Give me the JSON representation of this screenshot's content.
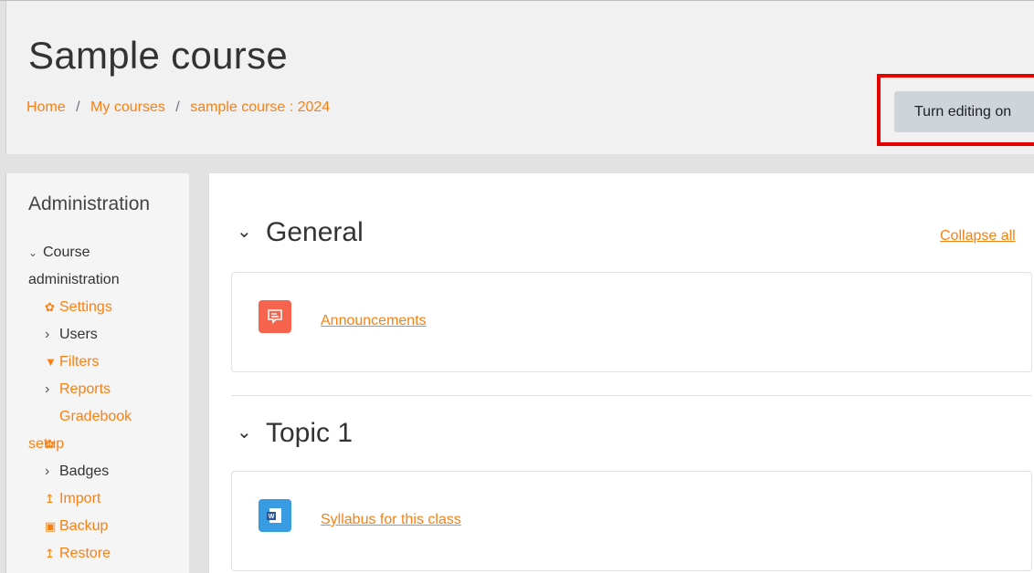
{
  "page": {
    "title": "Sample course"
  },
  "breadcrumb": {
    "items": [
      "Home",
      "My courses",
      "sample course : 2024"
    ],
    "separator": "/"
  },
  "header": {
    "edit_button_label": "Turn editing on"
  },
  "colors": {
    "accent": "#f98012",
    "highlight_border": "#e60000",
    "announcement_icon_bg": "#f7634d",
    "file_icon_bg": "#399be2"
  },
  "sidebar": {
    "title": "Administration",
    "section_label": "Course administration",
    "items": [
      {
        "label": "Settings",
        "icon": "gear-icon"
      },
      {
        "label": "Users",
        "icon": "chevron-right-icon"
      },
      {
        "label": "Filters",
        "icon": "filter-icon"
      },
      {
        "label": "Reports",
        "icon": "chevron-right-icon"
      },
      {
        "label": "Gradebook setup",
        "icon": "gear-icon"
      },
      {
        "label": "Badges",
        "icon": "chevron-right-icon"
      },
      {
        "label": "Import",
        "icon": "upload-icon"
      },
      {
        "label": "Backup",
        "icon": "file-icon"
      },
      {
        "label": "Restore",
        "icon": "upload-icon"
      }
    ]
  },
  "main": {
    "collapse_all_label": "Collapse all",
    "sections": [
      {
        "title": "General",
        "activities": [
          {
            "name": "Announcements",
            "icon": "forum-icon"
          }
        ]
      },
      {
        "title": "Topic 1",
        "activities": [
          {
            "name": "Syllabus for this class",
            "icon": "word-document-icon"
          }
        ]
      }
    ]
  }
}
